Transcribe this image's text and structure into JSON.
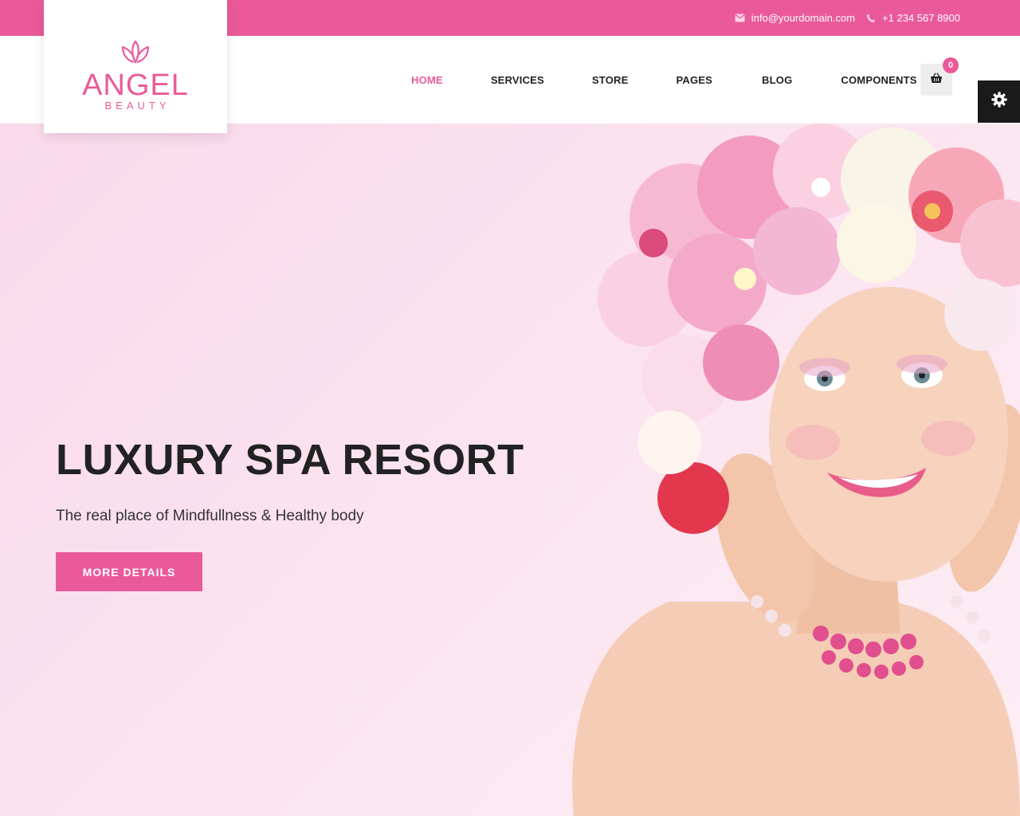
{
  "topbar": {
    "email": "info@yourdomain.com",
    "phone": "+1 234 567 8900"
  },
  "logo": {
    "name": "ANGEL",
    "tagline": "BEAUTY"
  },
  "nav": {
    "items": [
      {
        "label": "HOME",
        "active": true
      },
      {
        "label": "SERVICES",
        "active": false
      },
      {
        "label": "STORE",
        "active": false
      },
      {
        "label": "PAGES",
        "active": false
      },
      {
        "label": "BLOG",
        "active": false
      },
      {
        "label": "COMPONENTS",
        "active": false
      }
    ],
    "cart_count": "0"
  },
  "hero": {
    "title": "LUXURY SPA RESORT",
    "subtitle": "The real place of Mindfullness & Healthy body",
    "button": "MORE DETAILS"
  },
  "icons": {
    "email": "envelope-icon",
    "phone": "phone-icon",
    "cart": "basket-icon",
    "settings": "gear-icon",
    "logo": "lotus-icon"
  },
  "colors": {
    "accent": "#ea5a9a",
    "dark": "#1a1a1a",
    "hero_bg": "#fbe3ef"
  }
}
